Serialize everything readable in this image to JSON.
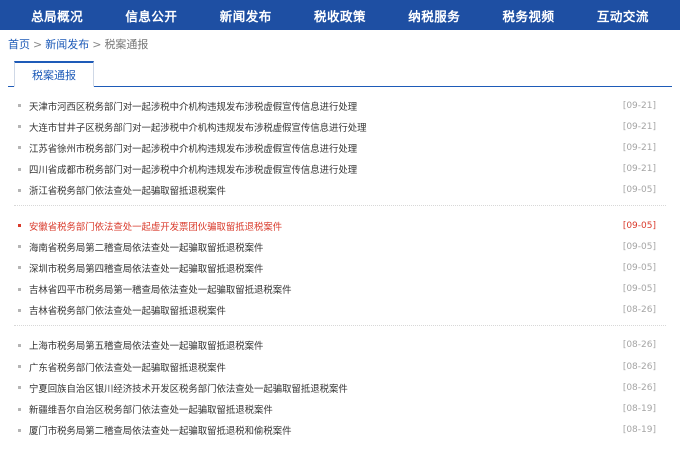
{
  "nav": [
    "总局概况",
    "信息公开",
    "新闻发布",
    "税收政策",
    "纳税服务",
    "税务视频",
    "互动交流"
  ],
  "breadcrumb": {
    "home": "首页",
    "section": "新闻发布",
    "current": "税案通报",
    "separator": ">"
  },
  "tab": {
    "label": "税案通报"
  },
  "colors": {
    "nav_bg": "#1e4fa3",
    "link": "#1e5bb8",
    "highlight": "#d93a2b"
  },
  "news_groups": [
    [
      {
        "title": "天津市河西区税务部门对一起涉税中介机构违规发布涉税虚假宣传信息进行处理",
        "date": "[09-21]"
      },
      {
        "title": "大连市甘井子区税务部门对一起涉税中介机构违规发布涉税虚假宣传信息进行处理",
        "date": "[09-21]"
      },
      {
        "title": "江苏省徐州市税务部门对一起涉税中介机构违规发布涉税虚假宣传信息进行处理",
        "date": "[09-21]"
      },
      {
        "title": "四川省成都市税务部门对一起涉税中介机构违规发布涉税虚假宣传信息进行处理",
        "date": "[09-21]"
      },
      {
        "title": "浙江省税务部门依法查处一起骗取留抵退税案件",
        "date": "[09-05]"
      }
    ],
    [
      {
        "title": "安徽省税务部门依法查处一起虚开发票团伙骗取留抵退税案件",
        "date": "[09-05]",
        "highlight": true
      },
      {
        "title": "海南省税务局第二稽查局依法查处一起骗取留抵退税案件",
        "date": "[09-05]"
      },
      {
        "title": "深圳市税务局第四稽查局依法查处一起骗取留抵退税案件",
        "date": "[09-05]"
      },
      {
        "title": "吉林省四平市税务局第一稽查局依法查处一起骗取留抵退税案件",
        "date": "[09-05]"
      },
      {
        "title": "吉林省税务部门依法查处一起骗取留抵退税案件",
        "date": "[08-26]"
      }
    ],
    [
      {
        "title": "上海市税务局第五稽查局依法查处一起骗取留抵退税案件",
        "date": "[08-26]"
      },
      {
        "title": "广东省税务部门依法查处一起骗取留抵退税案件",
        "date": "[08-26]"
      },
      {
        "title": "宁夏回族自治区银川经济技术开发区税务部门依法查处一起骗取留抵退税案件",
        "date": "[08-26]"
      },
      {
        "title": "新疆维吾尔自治区税务部门依法查处一起骗取留抵退税案件",
        "date": "[08-19]"
      },
      {
        "title": "厦门市税务局第二稽查局依法查处一起骗取留抵退税和偷税案件",
        "date": "[08-19]"
      }
    ]
  ]
}
